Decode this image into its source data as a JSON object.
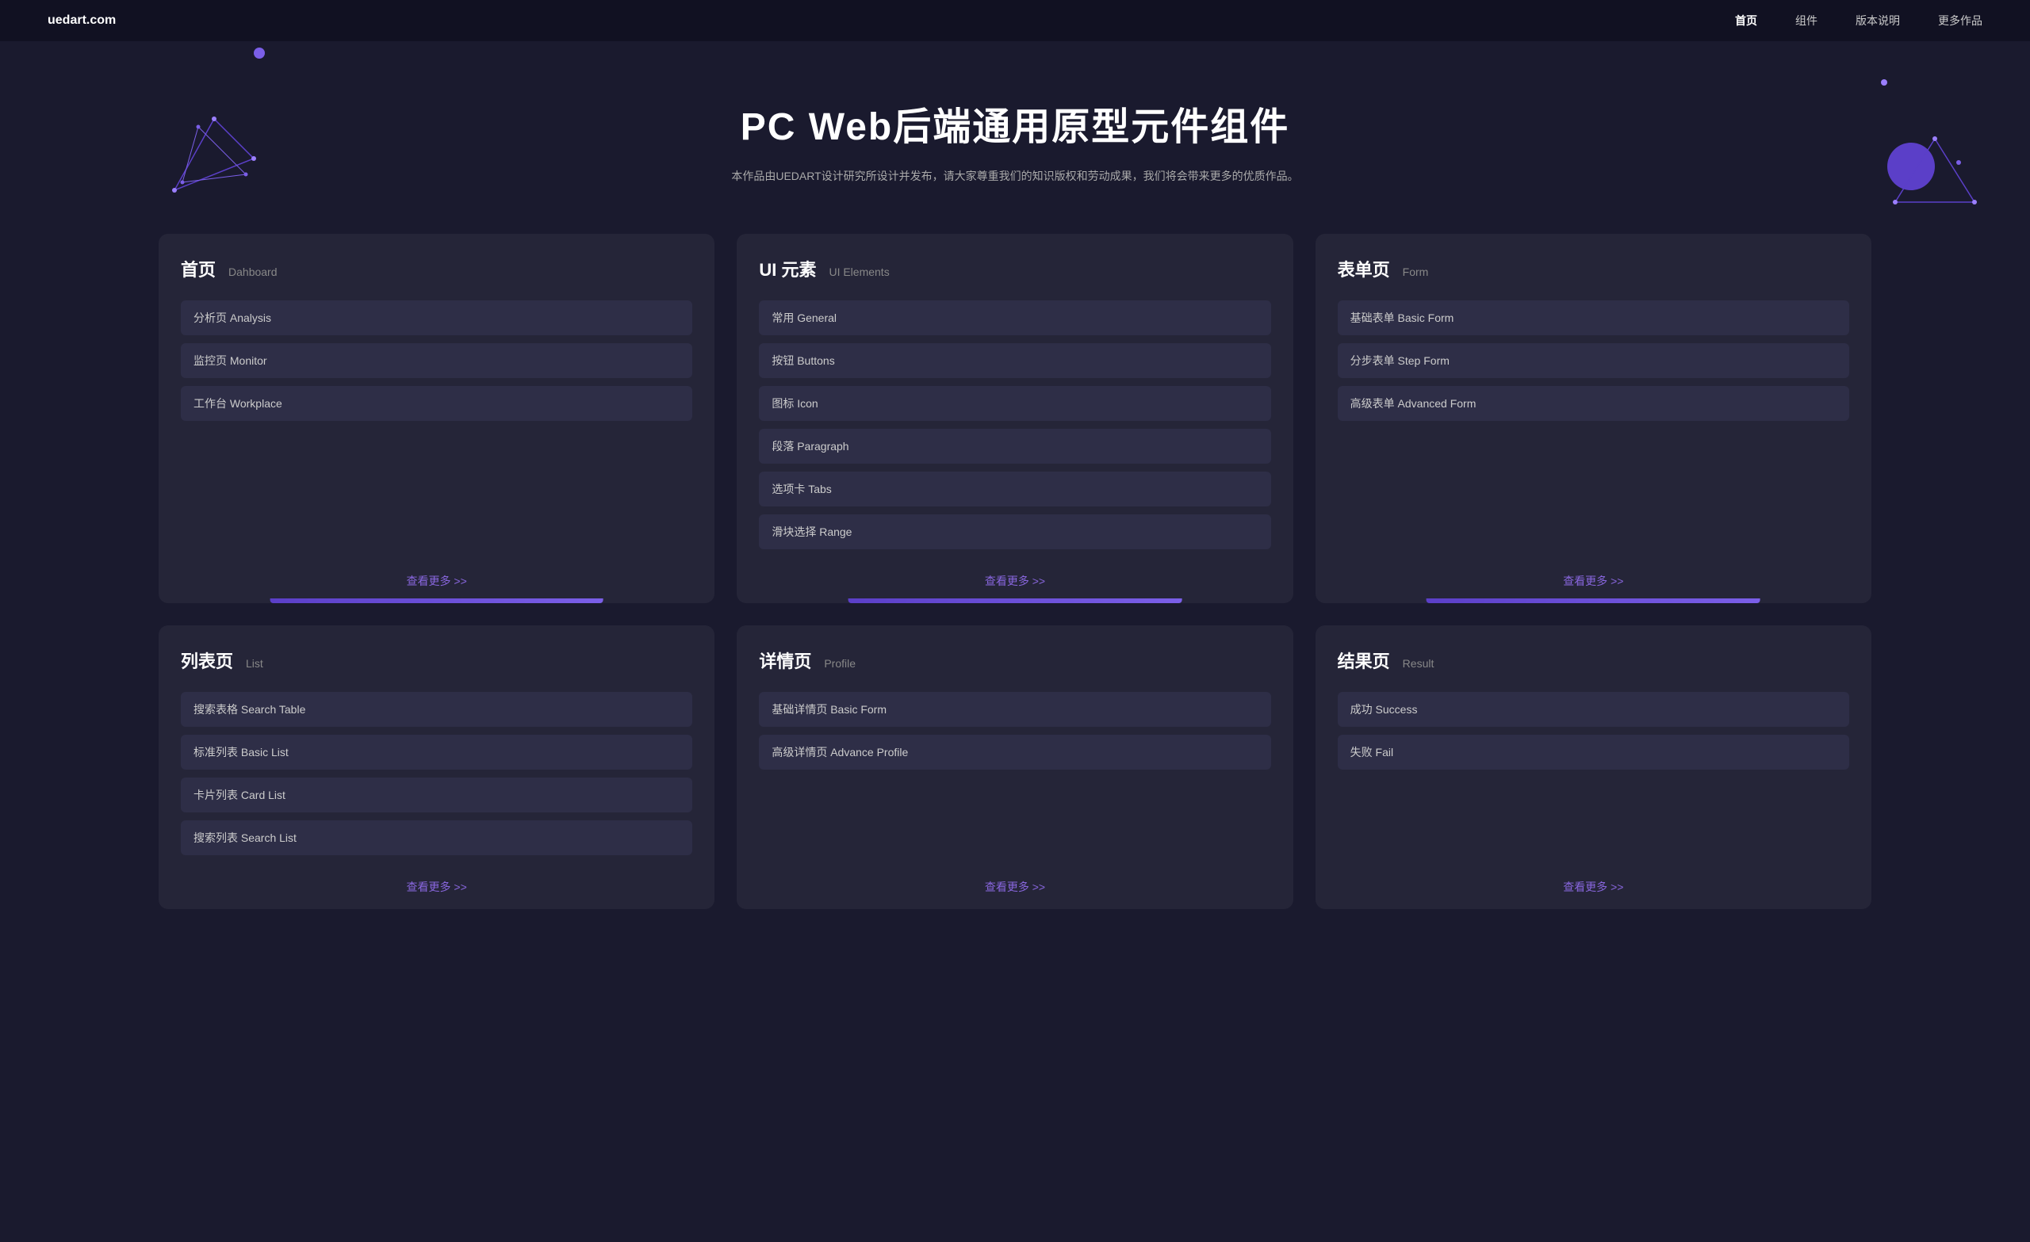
{
  "nav": {
    "logo": "uedart.com",
    "links": [
      {
        "label": "首页",
        "active": true
      },
      {
        "label": "组件",
        "active": false
      },
      {
        "label": "版本说明",
        "active": false
      },
      {
        "label": "更多作品",
        "active": false
      }
    ]
  },
  "hero": {
    "title": "PC Web后端通用原型元件组件",
    "subtitle": "本作品由UEDART设计研究所设计并发布，请大家尊重我们的知识版权和劳动成果，我们将会带来更多的优质作品。"
  },
  "cards_row1": [
    {
      "title_zh": "首页",
      "title_en": "Dahboard",
      "items": [
        {
          "label": "分析页 Analysis"
        },
        {
          "label": "监控页 Monitor"
        },
        {
          "label": "工作台 Workplace"
        }
      ],
      "footer": "查看更多 >>"
    },
    {
      "title_zh": "UI 元素",
      "title_en": "UI Elements",
      "items": [
        {
          "label": "常用 General"
        },
        {
          "label": "按钮 Buttons"
        },
        {
          "label": "图标 Icon"
        },
        {
          "label": "段落 Paragraph"
        },
        {
          "label": "选项卡 Tabs"
        },
        {
          "label": "滑块选择 Range"
        }
      ],
      "footer": "查看更多 >>"
    },
    {
      "title_zh": "表单页",
      "title_en": "Form",
      "items": [
        {
          "label": "基础表单 Basic Form"
        },
        {
          "label": "分步表单 Step Form"
        },
        {
          "label": "高级表单 Advanced Form"
        }
      ],
      "footer": "查看更多 >>"
    }
  ],
  "cards_row2": [
    {
      "title_zh": "列表页",
      "title_en": "List",
      "items": [
        {
          "label": "搜索表格 Search Table"
        },
        {
          "label": "标准列表 Basic List"
        },
        {
          "label": "卡片列表 Card List"
        },
        {
          "label": "搜索列表 Search List"
        }
      ],
      "footer": "查看更多 >>"
    },
    {
      "title_zh": "详情页",
      "title_en": "Profile",
      "items": [
        {
          "label": "基础详情页 Basic Form"
        },
        {
          "label": "高级详情页 Advance Profile"
        }
      ],
      "footer": "查看更多 >>"
    },
    {
      "title_zh": "结果页",
      "title_en": "Result",
      "items": [
        {
          "label": "成功 Success"
        },
        {
          "label": "失败 Fail"
        }
      ],
      "footer": "查看更多 >>"
    }
  ]
}
